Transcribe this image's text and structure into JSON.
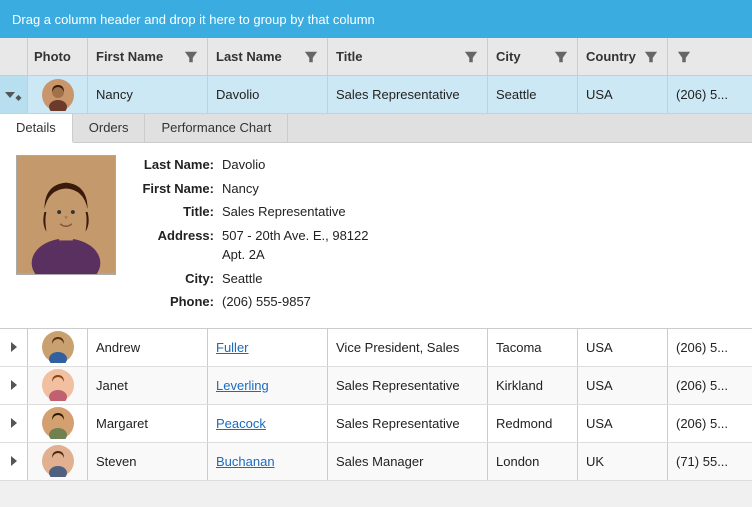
{
  "dragbar": {
    "text": "Drag a column header and drop it here to group by that column"
  },
  "columns": {
    "photo": "Photo",
    "firstName": "First Name",
    "lastName": "Last Name",
    "title": "Title",
    "city": "City",
    "country": "Country"
  },
  "selectedRow": {
    "firstName": "Nancy",
    "lastName": "Davolio",
    "title": "Sales Representative",
    "city": "Seattle",
    "country": "USA",
    "phone": "(206) 5..."
  },
  "tabs": [
    "Details",
    "Orders",
    "Performance Chart"
  ],
  "activeTab": "Details",
  "detail": {
    "lastName": {
      "label": "Last Name:",
      "value": "Davolio"
    },
    "firstName": {
      "label": "First Name:",
      "value": "Nancy"
    },
    "title": {
      "label": "Title:",
      "value": "Sales Representative"
    },
    "address": {
      "label": "Address:",
      "value": "507 - 20th Ave. E., 98122",
      "value2": "Apt. 2A"
    },
    "city": {
      "label": "City:",
      "value": "Seattle"
    },
    "phone": {
      "label": "Phone:",
      "value": "(206) 555-9857"
    }
  },
  "rows": [
    {
      "firstName": "Andrew",
      "lastName": "Fuller",
      "title": "Vice President, Sales",
      "city": "Tacoma",
      "country": "USA",
      "phone": "(206) 5..."
    },
    {
      "firstName": "Janet",
      "lastName": "Leverling",
      "title": "Sales Representative",
      "city": "Kirkland",
      "country": "USA",
      "phone": "(206) 5..."
    },
    {
      "firstName": "Margaret",
      "lastName": "Peacock",
      "title": "Sales Representative",
      "city": "Redmond",
      "country": "USA",
      "phone": "(206) 5..."
    },
    {
      "firstName": "Steven",
      "lastName": "Buchanan",
      "title": "Sales Manager",
      "city": "London",
      "country": "UK",
      "phone": "(71) 55..."
    }
  ]
}
